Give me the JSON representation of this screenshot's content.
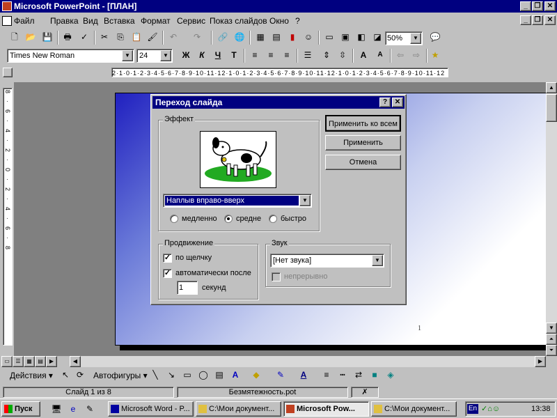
{
  "app": {
    "title": "Microsoft PowerPoint - [ПЛАН]"
  },
  "menu": [
    "Файл",
    "Правка",
    "Вид",
    "Вставка",
    "Формат",
    "Сервис",
    "Показ слайдов",
    "Окно",
    "?"
  ],
  "toolbar": {
    "zoom": "50%"
  },
  "format_toolbar": {
    "font": "Times New Roman",
    "size": "24"
  },
  "ruler": {
    "h_text": "2·1·0·1·2·3·4·5·6·7·8·9·10·11·12·1·0·1·2·3·4·5·6·7·8·9·10·11·12·1·0·1·2·3·4·5·6·7·8·9·10·11·12",
    "v_text": "8·6·4·2·0·2·4·6·8"
  },
  "slide": {
    "page_number": "1"
  },
  "dialog": {
    "title": "Переход слайда",
    "help": "?",
    "close": "✕",
    "effect_group": "Эффект",
    "effect_value": "Наплыв вправо-вверх",
    "speed_slow": "медленно",
    "speed_medium": "средне",
    "speed_fast": "быстро",
    "apply_all": "Применить ко всем",
    "apply": "Применить",
    "cancel": "Отмена",
    "advance_group": "Продвижение",
    "on_click": "по щелчку",
    "auto_after": "автоматически после",
    "seconds_value": "1",
    "seconds_label": "секунд",
    "sound_group": "Звук",
    "sound_value": "[Нет звука]",
    "loop_label": "непрерывно"
  },
  "drawing_toolbar": {
    "actions": "Действия",
    "autoshapes": "Автофигуры"
  },
  "status": {
    "slide": "Слайд 1 из 8",
    "design": "Безмятежность.pot"
  },
  "taskbar": {
    "start": "Пуск",
    "tasks": [
      "Microsoft Word - P...",
      "C:\\Мои документ...",
      "Microsoft Pow...",
      "C:\\Мои документ..."
    ],
    "lang": "En",
    "time": "13:38"
  }
}
